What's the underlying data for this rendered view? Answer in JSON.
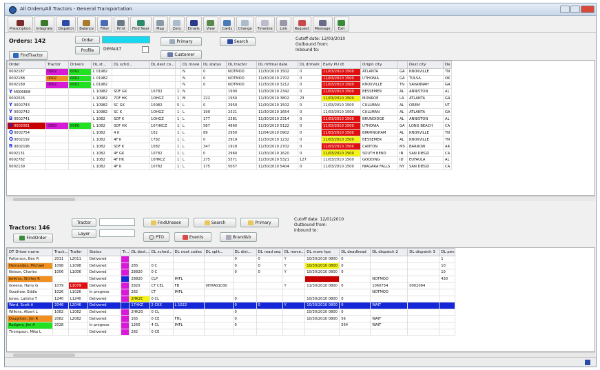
{
  "window": {
    "title": "All Orders/All Tractors - General Transportation"
  },
  "toolbar": [
    {
      "icon": "truck-icon",
      "label": "Prescription",
      "color": "#7a2a2a"
    },
    {
      "icon": "truck-icon",
      "label": "Integrate",
      "color": "#3a7a2a"
    },
    {
      "icon": "person-icon",
      "label": "Dispatch",
      "color": "#2a4aa8"
    },
    {
      "icon": "balance-icon",
      "label": "Balance",
      "color": "#a87a2a"
    },
    {
      "icon": "filter-icon",
      "label": "Filter",
      "color": "#4a6ab8"
    },
    {
      "icon": "print-icon",
      "label": "Print",
      "color": "#6a7a88"
    },
    {
      "icon": "globe-icon",
      "label": "Find Near",
      "color": "#2a8a6a"
    },
    {
      "icon": "map-icon",
      "label": "Map",
      "color": "#8a9aa8"
    },
    {
      "icon": "zoom-icon",
      "label": "Zero",
      "color": "#aabbcc"
    },
    {
      "icon": "email-icon",
      "label": "Emails",
      "color": "#2a3a8a"
    },
    {
      "icon": "view-icon",
      "label": "View",
      "color": "#5a8a4a"
    },
    {
      "icon": "cards-icon",
      "label": "Cards",
      "color": "#4a7ab8"
    },
    {
      "icon": "change-icon",
      "label": "Change",
      "color": "#aabbcc"
    },
    {
      "icon": "timeline-icon",
      "label": "Timeline",
      "color": "#bbc"
    },
    {
      "icon": "links-icon",
      "label": "Link",
      "color": "#99a"
    },
    {
      "icon": "request-icon",
      "label": "Request",
      "color": "#c84a4a"
    },
    {
      "icon": "message-icon",
      "label": "Message",
      "color": "#6a6a8a"
    },
    {
      "icon": "exit-icon",
      "label": "Exit",
      "color": "#3a8a3a"
    }
  ],
  "orders": {
    "count_label": "Orders: 142",
    "order_btn": "Order",
    "profile_btn": "Profile",
    "profile_value": "DEFAULT",
    "primary_btn": "Primary",
    "search_btn": "Search",
    "customer_btn": "Customer",
    "findtractor_btn": "FindTractor",
    "cutoff": "Cutoff date: 12/03/2010",
    "outbound": "Outbound from:",
    "inbound": "Inbound to:",
    "columns": [
      "Order",
      "Tractor",
      "Drivers",
      "DL st...",
      "DL schd...",
      "DL dest co...",
      "",
      "DL move",
      "DL status",
      "DL tractor",
      "DL mfimal date",
      "DL drmark",
      "Early PU dt",
      "Origin city",
      "",
      "Dest city",
      "De"
    ],
    "colors": {
      "magenta": "#d81ad8",
      "green": "#22e022",
      "orange": "#f09020",
      "red": "#e01010",
      "yellow": "#f4f418",
      "darkred": "#c80000",
      "blue": "#1428d8"
    },
    "rows": [
      {
        "icon": "",
        "c": [
          "0002187",
          "0002",
          "0002",
          "L 01982",
          "",
          "",
          "",
          "N",
          "0",
          "NOTMOD",
          "11/30/2010 1502",
          "0",
          "11/03/2010 1500",
          "ATLANTA",
          "GA",
          "KNOXVILLE",
          "TN"
        ],
        "bg": {
          "1": "magenta",
          "2": "green",
          "12": "red"
        }
      },
      {
        "icon": "",
        "c": [
          "0002188",
          "0002",
          "0002",
          "L 01982",
          "",
          "",
          "",
          "N",
          "0",
          "NOTMOD",
          "11/30/2010 2702",
          "0",
          "11/03/2010 1500",
          "UTHONIA",
          "GA",
          "TULSA",
          "OK"
        ],
        "bg": {
          "1": "orange",
          "2": "green",
          "12": "red"
        }
      },
      {
        "icon": "",
        "c": [
          "0002189",
          "0002",
          "0002",
          "L 01982",
          "",
          "",
          "",
          "N",
          "0",
          "NOTMOD",
          "11/30/2010 3212",
          "0",
          "11/03/2010 1500",
          "KNOXVILLE",
          "TN",
          "SAVANNAH",
          "GA"
        ],
        "bg": {
          "1": "magenta",
          "2": "green",
          "12": "red"
        }
      },
      {
        "icon": "Y",
        "c": [
          "M006808",
          "",
          "",
          "L 10982",
          "SDF GK",
          "10782",
          "1",
          "N",
          "",
          "1900",
          "11/30/2010 2342",
          "0",
          "11/03/2010 1500",
          "BESSEMER",
          "AL",
          "ANNISTON",
          "AL"
        ],
        "bg": {
          "12": "red"
        }
      },
      {
        "icon": "",
        "c": [
          "0002026",
          "",
          "",
          "L 10982",
          "7DF HK",
          "1OHGZ",
          "1",
          "M",
          "222",
          "1950",
          "11/30/2010 3802",
          "23",
          "11/03/2010 1500",
          "MONROE",
          "LA",
          "ATLANTA",
          "GA"
        ],
        "bg": {
          "12": "yellow"
        }
      },
      {
        "icon": "Y",
        "c": [
          "0002743",
          "",
          "",
          "L 10982",
          "SC GK",
          "10082",
          "5",
          "L",
          "0",
          "2950",
          "11/30/2010 1502",
          "0",
          "11/03/2010 1500",
          "CULLMAN",
          "AL",
          "OREM",
          "UT"
        ],
        "bg": {}
      },
      {
        "icon": "Y",
        "c": [
          "0002742",
          "",
          "",
          "L 10982",
          "SC K",
          "1OHGZ",
          "1",
          "L",
          "199",
          "2321",
          "11/30/2010 1654",
          "0",
          "11/03/2010 1500",
          "CULLMAN",
          "AL",
          "ATLANTA",
          "GA"
        ],
        "bg": {}
      },
      {
        "icon": "B",
        "c": [
          "0002741",
          "",
          "",
          "L 1082",
          "SDF K",
          "1OHGZ",
          "1",
          "L",
          "177",
          "2381",
          "11/30/2010 2314",
          "0",
          "11/03/2010 1500",
          "BRUNDIDGE",
          "AL",
          "ANNISTON",
          "AL"
        ],
        "bg": {
          "12": "red"
        }
      },
      {
        "icon": "B",
        "c": [
          "0002081",
          "0000",
          "0000",
          "L 1082",
          "SDF HK",
          "10?HKCZ",
          "1",
          "L",
          "587",
          "4860",
          "11/30/2010 5122",
          "0",
          "11/03/2010 1500",
          "UTHONIA",
          "GA",
          "LONG BEACH",
          "CA"
        ],
        "bg": {
          "0": "darkred",
          "1": "magenta",
          "2": "green",
          "12": "red"
        }
      },
      {
        "icon": "Q",
        "c": [
          "0002754",
          "",
          "",
          "L 1082",
          "4 K",
          "102",
          "1",
          "L",
          "89",
          "2950",
          "11/04/2010 0902",
          "0",
          "11/03/2010 1500",
          "BIRMINGHAM",
          "AL",
          "KNOXVILLE",
          "TN"
        ],
        "bg": {
          "12": "red"
        }
      },
      {
        "icon": "Q",
        "c": [
          "0002192",
          "",
          "",
          "L 1082",
          "4F K",
          "1782",
          "1",
          "L",
          "0",
          "2919",
          "11/30/2010 1232",
          "0",
          "11/03/2010 1500",
          "BESSEMER",
          "AL",
          "KNOXVILLE",
          "TN"
        ],
        "bg": {
          "12": "yellow"
        }
      },
      {
        "icon": "B",
        "c": [
          "0002196",
          "",
          "",
          "L 1082",
          "SDF K",
          "1082",
          "1",
          "L",
          "347",
          "1918",
          "11/30/2010 2702",
          "0",
          "11/03/2010 1500",
          "CANTON",
          "MS",
          "BARROW",
          "AR"
        ],
        "bg": {
          "12": "red"
        }
      },
      {
        "icon": "",
        "c": [
          "0002131",
          "",
          "",
          "L 1082",
          "4F GK",
          "10782",
          "1",
          "L",
          "0",
          "2960",
          "11/30/2010 1620",
          "0",
          "11/03/2010 1500",
          "SOUTH BEND",
          "IN",
          "SAN DIEGO",
          "CA"
        ],
        "bg": {
          "12": "yellow"
        }
      },
      {
        "icon": "",
        "c": [
          "0002782",
          "",
          "",
          "L 1082",
          "4F HK",
          "10HKCZ",
          "1",
          "L",
          "275",
          "5571",
          "11/30/2010 5321",
          "127",
          "11/03/2010 1500",
          "GOODING",
          "ID",
          "EUFAULA",
          "AL"
        ],
        "bg": {}
      },
      {
        "icon": "",
        "c": [
          "0002139",
          "",
          "",
          "L 1082",
          "4F K",
          "10782",
          "1",
          "L",
          "175",
          "5057",
          "11/30/2010 5404",
          "0",
          "11/03/2010 1500",
          "NIAGARA FALLS",
          "NY",
          "SAN DIEGO",
          "CA"
        ],
        "bg": {}
      }
    ]
  },
  "tractors": {
    "count_label": "Tractors: 146",
    "tractor_btn": "Tractor",
    "layer_btn": "Layer",
    "findorder_btn": "FindOrder",
    "findunseen_btn": "FindUnseen",
    "search_btn": "Search",
    "primary_btn": "Primary",
    "pto_btn": "PTO",
    "events_btn": "Events",
    "brand_btn": "Brand&b",
    "cutoff": "Cutoff date: 12/01/2010",
    "outbound": "Outbound from:",
    "inbound": "Inbound to:",
    "columns": [
      "DT Driver name",
      "Truck...",
      "Trailer",
      "Status",
      "Tr...",
      "DL dest...",
      "DL sched...",
      "DL noot codes",
      "DL split...",
      "DL dist...",
      "DL read seq",
      "DL move...",
      "DL more hps",
      "DL deadhead",
      "DL dispatch 2",
      "DL dispatch 3",
      "DL pen"
    ],
    "rows": [
      {
        "c": [
          "Patterson, Ben R",
          "2011",
          "L2011",
          "Delivered",
          "",
          "",
          "",
          "",
          "",
          "0",
          "0",
          "Y",
          "10/30/2010 0800",
          "0",
          "",
          "",
          "1"
        ],
        "bg": {
          "4": "magenta"
        }
      },
      {
        "c": [
          "Hernandez, Michael",
          "1098",
          "L1098",
          "Delivered",
          "",
          "285",
          "0 C",
          "",
          "",
          "0",
          "0",
          "Y",
          "10/30/2010 0800",
          "0",
          "",
          "",
          "10"
        ],
        "bg": {
          "0": "orange",
          "4": "magenta",
          "12": "yellow"
        }
      },
      {
        "c": [
          "Nelson, Charles",
          "1006",
          "L1006",
          "Delivered",
          "",
          "28820",
          "0 C",
          "",
          "",
          "0",
          "0",
          "Y",
          "10/30/2010 0800",
          "0",
          "",
          "",
          "10"
        ],
        "bg": {
          "4": "magenta"
        }
      },
      {
        "c": [
          "Jenkins, Shirley R",
          "",
          "",
          "Delivered",
          "",
          "28820",
          "CLP",
          "IMFL",
          "",
          "",
          "",
          "",
          "",
          "",
          "NOTMOD",
          "",
          "430"
        ],
        "bg": {
          "0": "orange",
          "4": "blue",
          "12": "darkred"
        }
      },
      {
        "c": [
          "Greene, Harry G",
          "1079",
          "L1079",
          "Delivered",
          "",
          "2820",
          "CT CEL",
          "FB",
          "0HHA01030",
          "",
          "",
          "Y",
          "11/30/2010 0800",
          "0",
          "1060754",
          "0002064",
          ""
        ],
        "bg": {
          "4": "magenta",
          "2": "red"
        }
      },
      {
        "c": [
          "Goodrow, Eddie",
          "1026",
          "L1026",
          "In progress",
          "",
          "282",
          "CT",
          "IMFL",
          "",
          "",
          "",
          "",
          "",
          "",
          "NOTMOD",
          "",
          ""
        ],
        "bg": {
          "4": "magenta"
        }
      },
      {
        "c": [
          "Jones, Latisha T",
          "1240",
          "L1240",
          "Delivered",
          "",
          "2HK2C",
          "0 CL",
          "",
          "",
          "0",
          "",
          "",
          "10/30/2010 0800",
          "0",
          "",
          "",
          ""
        ],
        "bg": {
          "4": "magenta",
          "5": "yellow"
        }
      },
      {
        "c": [
          "Ward, Scott A",
          "2046",
          "L2046",
          "Delivered",
          "",
          "17HKZ",
          "2 CKX",
          "L 1022",
          "",
          "0",
          "0",
          "Y",
          "10/30/2010 0800",
          "0",
          "WAIT",
          "",
          ""
        ],
        "bg": {},
        "sel": true
      },
      {
        "c": [
          "Wilkins, Albert L",
          "1082",
          "L1082",
          "Delivered",
          "",
          "2HK20",
          "0 CL",
          "",
          "",
          "0",
          "",
          "",
          "10/30/2010 0800",
          "0",
          "",
          "",
          ""
        ],
        "bg": {
          "4": "magenta"
        }
      },
      {
        "c": [
          "Doughton, Jim R",
          "2082",
          "L2082",
          "Delivered",
          "",
          "165",
          "0 CE",
          "FHL",
          "",
          "0",
          "",
          "",
          "10/30/2010 0800",
          "56",
          "WAIT",
          "",
          ""
        ],
        "bg": {
          "0": "orange",
          "4": "magenta"
        }
      },
      {
        "c": [
          "Rodgers, Jim A",
          "2028",
          "",
          "In progress",
          "",
          "1260",
          "4 CL",
          "IMFL",
          "",
          "0",
          "",
          "",
          "",
          "564",
          "WAIT",
          "",
          ""
        ],
        "bg": {
          "0": "green",
          "4": "magenta"
        }
      },
      {
        "c": [
          "Thompson, Mike L",
          "",
          "",
          "Delivered",
          "",
          "282",
          "0 CE",
          "",
          "",
          "",
          "",
          "",
          "",
          "",
          "",
          "",
          ""
        ],
        "bg": {
          "4": "magenta"
        }
      }
    ]
  }
}
